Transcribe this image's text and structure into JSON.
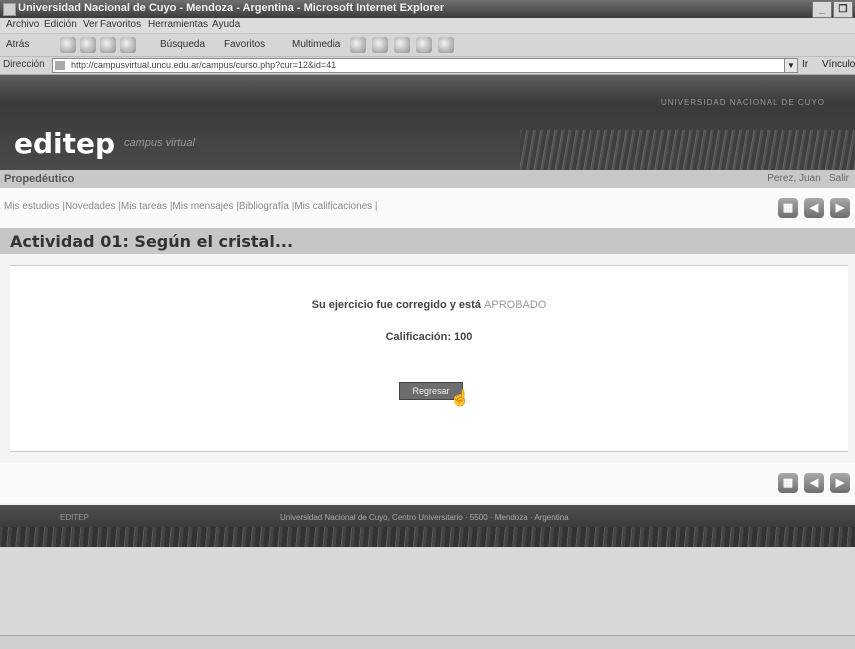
{
  "window": {
    "title": "Universidad Nacional de Cuyo - Mendoza - Argentina - Microsoft Internet Explorer",
    "minimize": "_",
    "restore": "❐"
  },
  "menu": [
    "Archivo",
    "Edición",
    "Ver",
    "Favoritos",
    "Herramientas",
    "Ayuda"
  ],
  "toolbar": {
    "back": "Atrás",
    "search": "Búsqueda",
    "favorites": "Favoritos",
    "multimedia": "Multimedia"
  },
  "address": {
    "label": "Dirección",
    "url": "http://campusvirtual.uncu.edu.ar/campus/curso.php?cur=12&id=41",
    "go": "Ir",
    "links": "Vínculos"
  },
  "site": {
    "university": "UNIVERSIDAD NACIONAL DE CUYO",
    "logo": "editep",
    "subtitle": "campus virtual"
  },
  "breadcrumb": {
    "course": "Propedéutico",
    "user": "Perez, Juan",
    "exit": "Salir"
  },
  "nav": {
    "links": "Mis estudios |Novedades |Mis tareas |Mis mensajes |Bibliografía |Mis calificaciones |"
  },
  "activity": {
    "title": "Actividad 01: Según el cristal..."
  },
  "result": {
    "message": "Su ejercicio fue corregido y está",
    "status": "APROBADO",
    "score": "Calificación: 100",
    "button": "Regresar"
  },
  "footer": {
    "left": "EDITEP",
    "center": "Universidad Nacional de Cuyo, Centro Universitario · 5500 · Mendoza · Argentina"
  }
}
